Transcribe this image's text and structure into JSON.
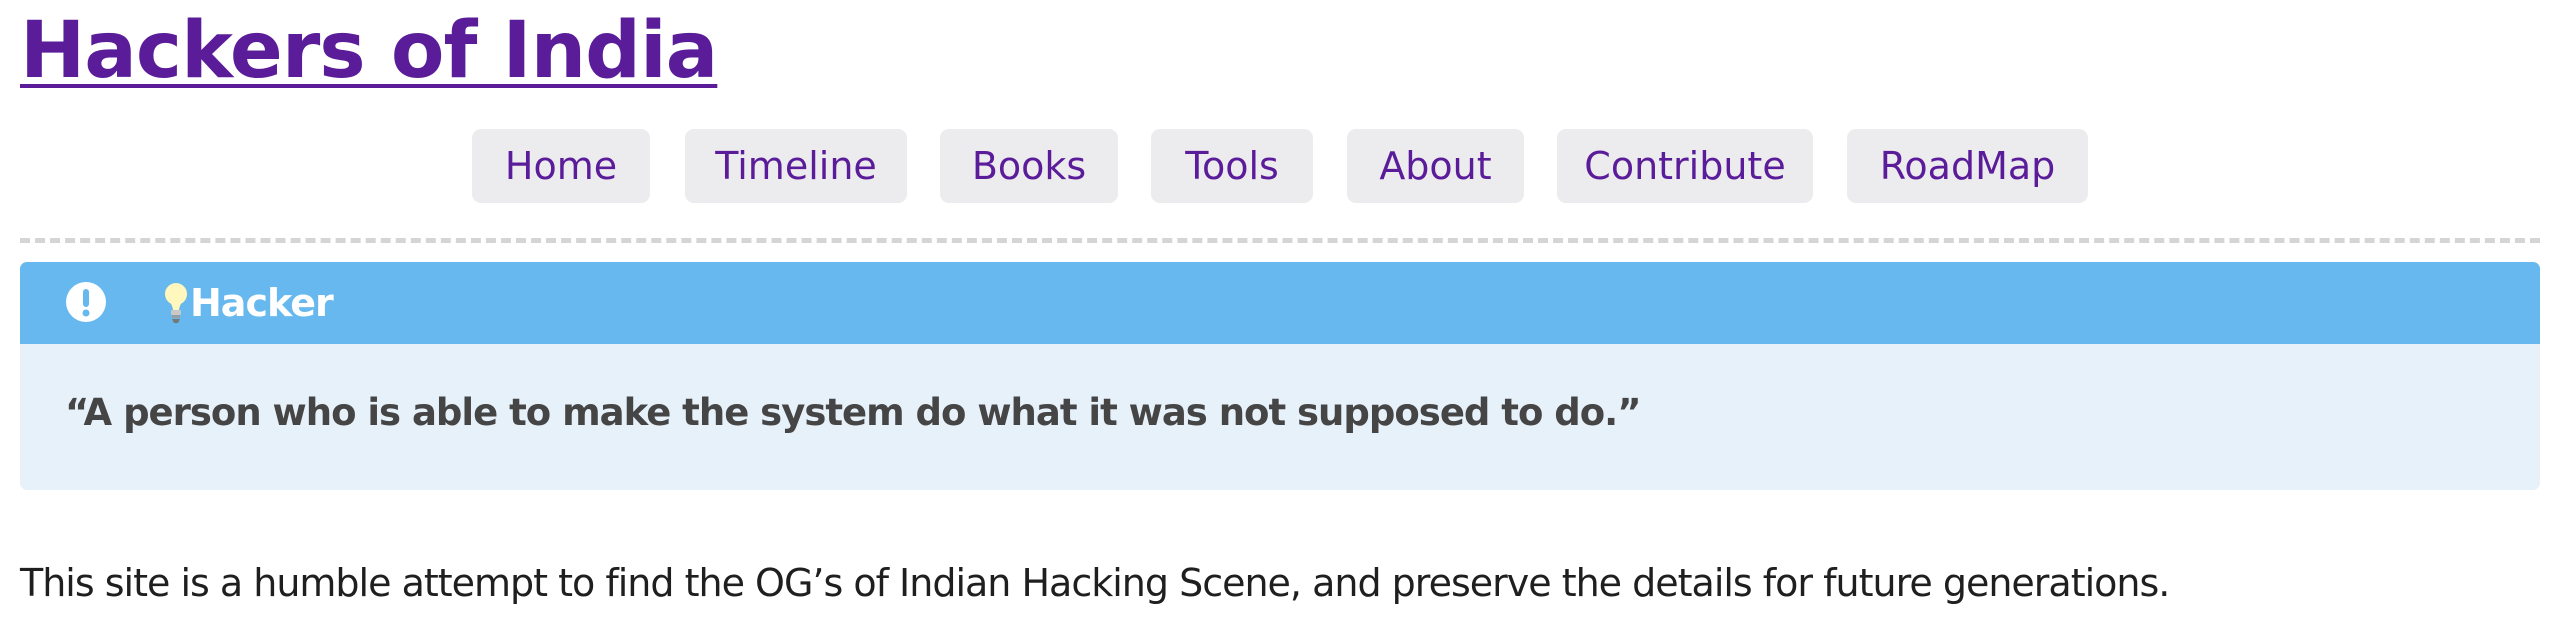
{
  "site": {
    "title": "Hackers of India"
  },
  "nav": {
    "items": [
      {
        "label": "Home"
      },
      {
        "label": "Timeline"
      },
      {
        "label": "Books"
      },
      {
        "label": "Tools"
      },
      {
        "label": "About"
      },
      {
        "label": "Contribute"
      },
      {
        "label": "RoadMap"
      }
    ]
  },
  "callout": {
    "header_icon": "exclamation-circle-icon",
    "title_icon": "lightbulb-icon",
    "title": "Hacker",
    "quote": "“A person who is able to make the system do what it was not supposed to do.”",
    "colors": {
      "header": "#67b8ee",
      "body": "#e7f1fa"
    }
  },
  "content": {
    "intro": "This site is a humble attempt to find the OG’s of Indian Hacking Scene, and preserve the details for future generations."
  },
  "colors": {
    "link": "#5b1c9a",
    "nav_background": "#ececee",
    "divider": "#d5d5d5",
    "text": "#1f1f1f"
  }
}
